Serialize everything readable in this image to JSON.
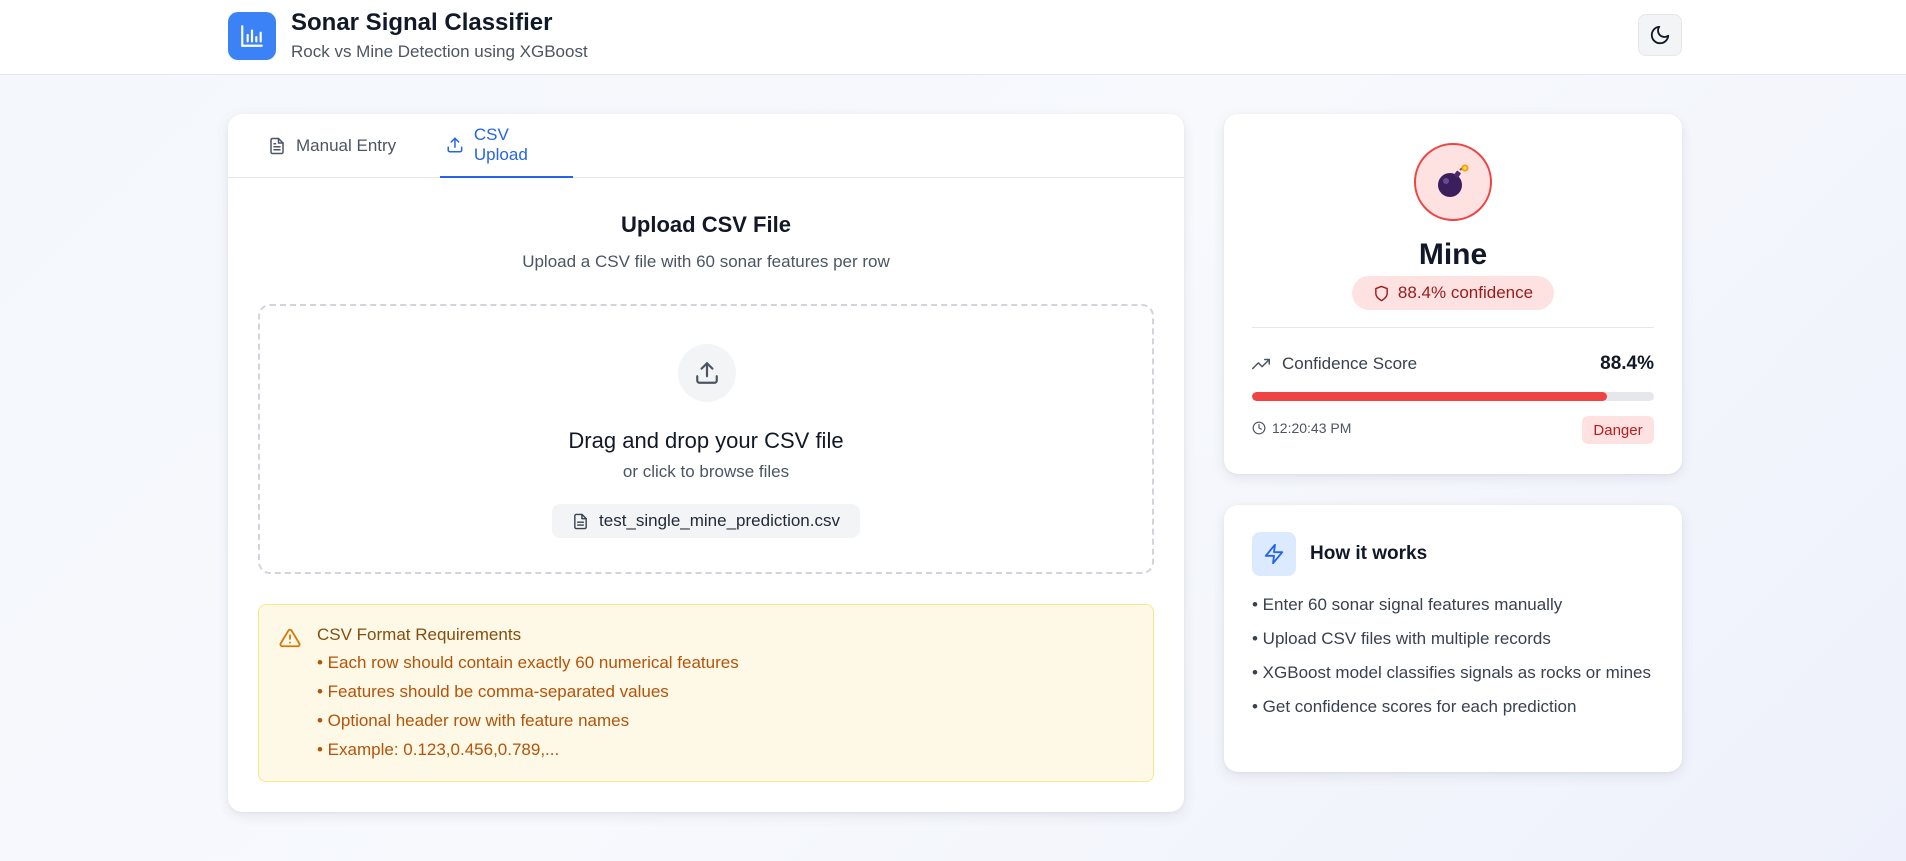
{
  "header": {
    "title": "Sonar Signal Classifier",
    "subtitle": "Rock vs Mine Detection using XGBoost",
    "logo_icon": "bar-chart-icon",
    "theme_icon": "moon-icon"
  },
  "tabs": [
    {
      "label": "Manual Entry",
      "icon": "file-text-icon",
      "active": false
    },
    {
      "label": "CSV Upload",
      "icon": "upload-icon",
      "active": true
    }
  ],
  "upload": {
    "title": "Upload CSV File",
    "description": "Upload a CSV file with 60 sonar features per row",
    "dropzone_title": "Drag and drop your CSV file",
    "dropzone_subtitle": "or click to browse files",
    "file_name": "test_single_mine_prediction.csv"
  },
  "requirements": {
    "title": "CSV Format Requirements",
    "items": [
      "• Each row should contain exactly 60 numerical features",
      "• Features should be comma-separated values",
      "• Optional header row with feature names",
      "• Example: 0.123,0.456,0.789,..."
    ]
  },
  "result": {
    "icon": "bomb-icon",
    "label": "Mine",
    "confidence_badge": "88.4% confidence",
    "score_label": "Confidence Score",
    "score_value": "88.4%",
    "score_fraction": 0.884,
    "time": "12:20:43 PM",
    "status": "Danger"
  },
  "how_it_works": {
    "title": "How it works",
    "items": [
      "• Enter 60 sonar signal features manually",
      "• Upload CSV files with multiple records",
      "• XGBoost model classifies signals as rocks or mines",
      "• Get confidence scores for each prediction"
    ]
  },
  "colors": {
    "accent": "#3b82f6",
    "danger": "#ef4444",
    "warning_bg": "#fef9e7",
    "warning_text": "#b45309"
  }
}
